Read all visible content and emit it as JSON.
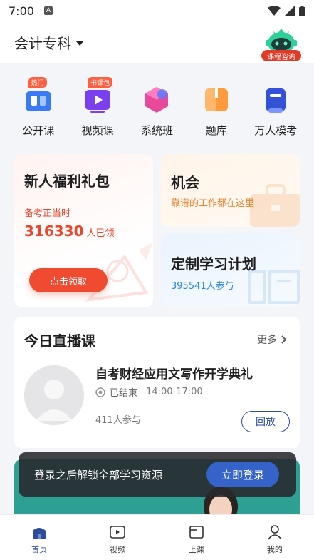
{
  "status_bar": {
    "time": "7:00",
    "notif_letter": "A"
  },
  "header": {
    "category": "会计专科",
    "consult_label": "课程咨询"
  },
  "quick_entries": [
    {
      "label": "公开课",
      "tag": "热门",
      "icon": "open-class-icon"
    },
    {
      "label": "视频课",
      "tag": "书课包",
      "icon": "video-class-icon"
    },
    {
      "label": "系统班",
      "tag": "",
      "icon": "system-class-icon"
    },
    {
      "label": "题库",
      "tag": "",
      "icon": "question-bank-icon"
    },
    {
      "label": "万人模考",
      "tag": "",
      "icon": "mock-exam-icon"
    }
  ],
  "welfare_card": {
    "title": "新人福利礼包",
    "subtitle": "备考正当时",
    "count": "316330",
    "count_suffix": "人已领",
    "button": "点击领取"
  },
  "job_card": {
    "title": "机会",
    "subtitle": "靠谱的工作都在这里"
  },
  "plan_card": {
    "title": "定制学习计划",
    "subtitle": "395541人参与"
  },
  "live_section": {
    "title": "今日直播课",
    "more": "更多",
    "course": {
      "name": "自考财经应用文写作开学典礼",
      "status": "已结束",
      "time": "14:00-17:00",
      "participants": "411人参与",
      "replay": "回放"
    }
  },
  "login_prompt": {
    "text": "登录之后解锁全部学习资源",
    "button": "立即登录"
  },
  "tabbar": [
    {
      "label": "首页",
      "icon": "home-icon",
      "active": true
    },
    {
      "label": "视频",
      "icon": "video-icon",
      "active": false
    },
    {
      "label": "上课",
      "icon": "class-icon",
      "active": false
    },
    {
      "label": "我的",
      "icon": "profile-icon",
      "active": false
    }
  ],
  "colors": {
    "accent": "#2d4c9a",
    "red": "#f04a30",
    "orange": "#e8822f",
    "blue": "#2f86d8"
  }
}
